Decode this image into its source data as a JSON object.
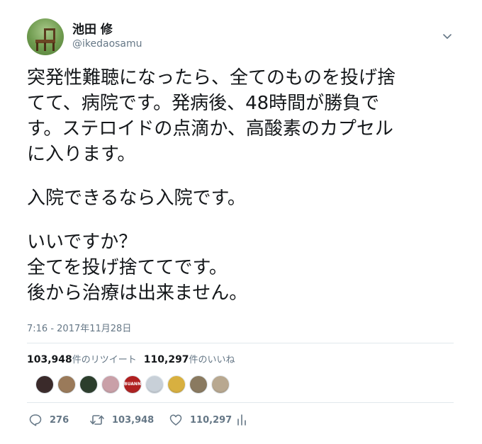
{
  "user": {
    "name": "池田 修",
    "handle": "@ikedaosamu"
  },
  "tweet": {
    "lines": [
      "突発性難聴になったら、全てのものを投げ捨",
      "てて、病院です。発病後、48時間が勝負で",
      "す。ステロイドの点滴か、高酸素のカプセル",
      "に入ります。",
      "",
      "入院できるなら入院です。",
      "",
      "いいですか？",
      "全てを投げ捨ててです。",
      "後から治療は出来ません。"
    ],
    "timestamp": "7:16 - 2017年11月28日"
  },
  "stats": {
    "retweet_count": "103,948",
    "retweet_label": "件のリツイート",
    "like_count": "110,297",
    "like_label": "件のいいね"
  },
  "likers": [
    {
      "icon": "liker-avatar",
      "color": "#3a2a2a"
    },
    {
      "icon": "liker-avatar",
      "color": "#9a7a5a"
    },
    {
      "icon": "liker-avatar",
      "color": "#2c3e2c"
    },
    {
      "icon": "liker-avatar",
      "color": "#c9a0a8"
    },
    {
      "icon": "liker-avatar",
      "color": "#b02020",
      "text": "BUANN"
    },
    {
      "icon": "liker-avatar",
      "color": "#c8d0d8"
    },
    {
      "icon": "liker-avatar",
      "color": "#d8b040"
    },
    {
      "icon": "liker-avatar",
      "color": "#8a7a60"
    },
    {
      "icon": "liker-avatar",
      "color": "#b8a890"
    }
  ],
  "actions": {
    "reply_count": "276",
    "retweet_count": "103,948",
    "like_count": "110,297"
  },
  "colors": {
    "text": "#14171a",
    "secondary": "#657786",
    "divider": "#e1e8ed"
  }
}
